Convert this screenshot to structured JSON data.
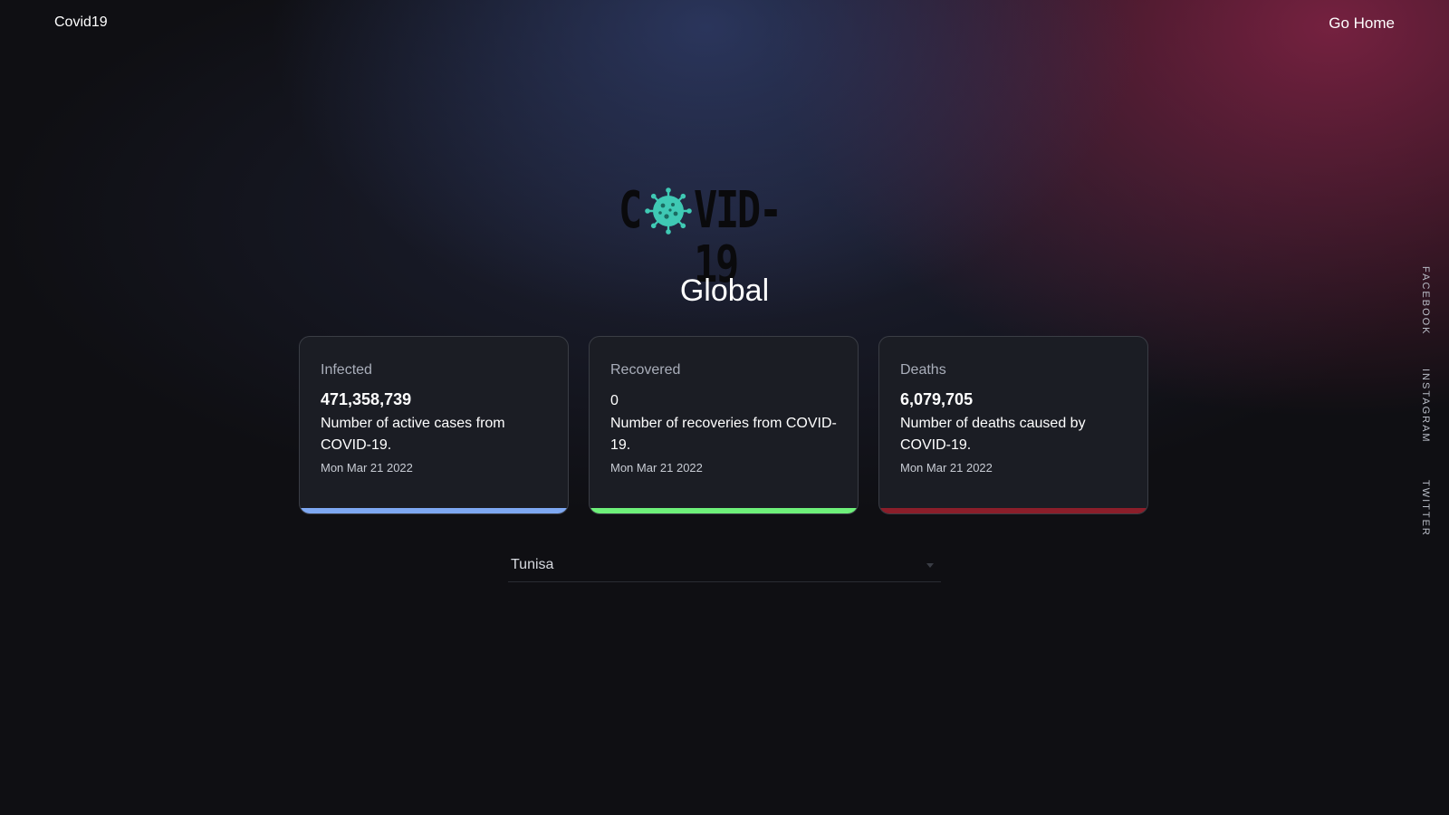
{
  "nav": {
    "brand": "Covid19",
    "go_home": "Go Home"
  },
  "logo": {
    "text_left": "C",
    "text_right": "VID-19",
    "icon": "virus-icon",
    "icon_color": "#3fc9b4"
  },
  "section_title": "Global",
  "cards": [
    {
      "label": "Infected",
      "value": "471,358,739",
      "description": "Number of active cases from COVID-19.",
      "date": "Mon Mar 21 2022",
      "color": "#7ea8f2"
    },
    {
      "label": "Recovered",
      "value": "0",
      "description": "Number of recoveries from COVID-19.",
      "date": "Mon Mar 21 2022",
      "color": "#6ef07a"
    },
    {
      "label": "Deaths",
      "value": "6,079,705",
      "description": "Number of deaths caused by COVID-19.",
      "date": "Mon Mar 21 2022",
      "color": "#8b1e2a"
    }
  ],
  "country_select": {
    "selected": "Tunisa"
  },
  "social": {
    "facebook": "FACEBOOK",
    "instagram": "INSTAGRAM",
    "twitter": "TWITTER"
  }
}
